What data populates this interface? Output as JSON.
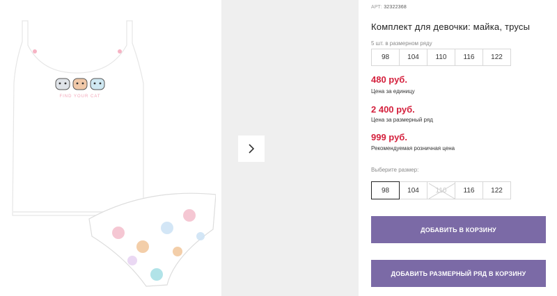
{
  "gallery": {
    "next_icon": "chevron-right-icon",
    "shirt_print_text": "FIND YOUR CAT"
  },
  "product": {
    "article_prefix": "АРТ:",
    "article_number": "32322368",
    "title": "Комплект для девочки: майка, трусы",
    "series_label": "5 шт. в размерном ряду",
    "series_sizes": [
      "98",
      "104",
      "110",
      "116",
      "122"
    ]
  },
  "prices": [
    {
      "value": "480 руб.",
      "label": "Цена за единицу"
    },
    {
      "value": "2 400 руб.",
      "label": "Цена за размерный ряд"
    },
    {
      "value": "999 руб.",
      "label": "Рекомендуемая розничная цена"
    }
  ],
  "size_picker": {
    "label": "Выберите размер:",
    "sizes": [
      "98",
      "104",
      "110",
      "116",
      "122"
    ],
    "selected": "98",
    "unavailable": "110"
  },
  "buttons": {
    "add_to_cart": "ДОБАВИТЬ В КОРЗИНУ",
    "add_series_to_cart": "ДОБАВИТЬ РАЗМЕРНЫЙ РЯД В КОРЗИНУ"
  },
  "colors": {
    "price": "#d4213d",
    "button": "#7b6aa6",
    "gallery_bg": "#efefef"
  }
}
